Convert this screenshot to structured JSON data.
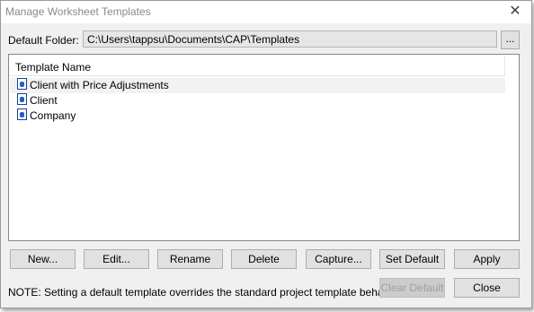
{
  "window": {
    "title": "Manage Worksheet Templates",
    "close_glyph": "✕"
  },
  "folder": {
    "label": "Default Folder:",
    "path": "C:\\Users\\tappsu\\Documents\\CAP\\Templates",
    "browse_label": "..."
  },
  "list": {
    "header": "Template Name",
    "items": [
      {
        "label": "Client with Price Adjustments",
        "selected": true
      },
      {
        "label": "Client",
        "selected": false
      },
      {
        "label": "Company",
        "selected": false
      }
    ]
  },
  "buttons": {
    "new": "New...",
    "edit": "Edit...",
    "rename": "Rename",
    "delete": "Delete",
    "capture": "Capture...",
    "set_default": "Set Default",
    "apply": "Apply",
    "clear_default": "Clear Default",
    "close": "Close"
  },
  "note": "NOTE: Setting a default template overrides the standard project template behavior",
  "icons": {
    "template_item": "template-file-icon"
  }
}
